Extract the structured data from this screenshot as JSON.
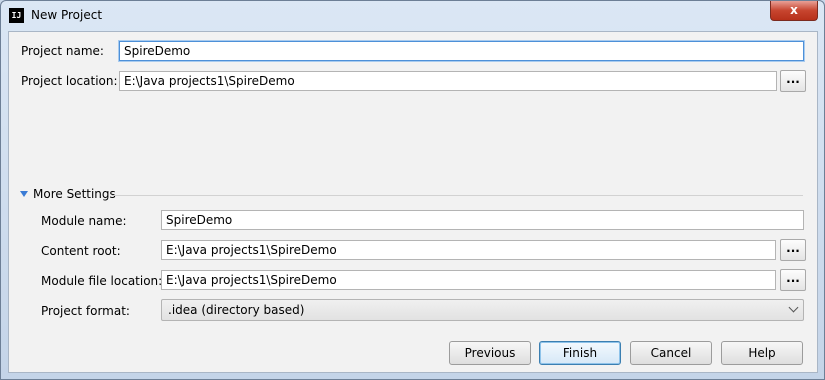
{
  "window": {
    "title": "New Project",
    "app_icon": "IJ",
    "close_label": "x"
  },
  "project": {
    "name_label": "Project name:",
    "name_value": "SpireDemo",
    "location_label": "Project location:",
    "location_value": "E:\\Java projects1\\SpireDemo",
    "browse_label": "..."
  },
  "more_settings": {
    "header": "More Settings",
    "module_name_label": "Module name:",
    "module_name_value": "SpireDemo",
    "content_root_label": "Content root:",
    "content_root_value": "E:\\Java projects1\\SpireDemo",
    "module_file_label": "Module file location:",
    "module_file_value": "E:\\Java projects1\\SpireDemo",
    "format_label": "Project format:",
    "format_value": ".idea (directory based)",
    "browse_label": "..."
  },
  "buttons": {
    "previous": "Previous",
    "finish": "Finish",
    "cancel": "Cancel",
    "help": "Help"
  },
  "colors": {
    "accent": "#4d90d8",
    "section_arrow": "#3a7bd5",
    "close_button": "#c7452f"
  },
  "icons": {
    "app": "intellij-logo-icon",
    "close": "close-icon",
    "section_toggle": "triangle-down-icon",
    "dropdown": "chevron-down-icon"
  }
}
